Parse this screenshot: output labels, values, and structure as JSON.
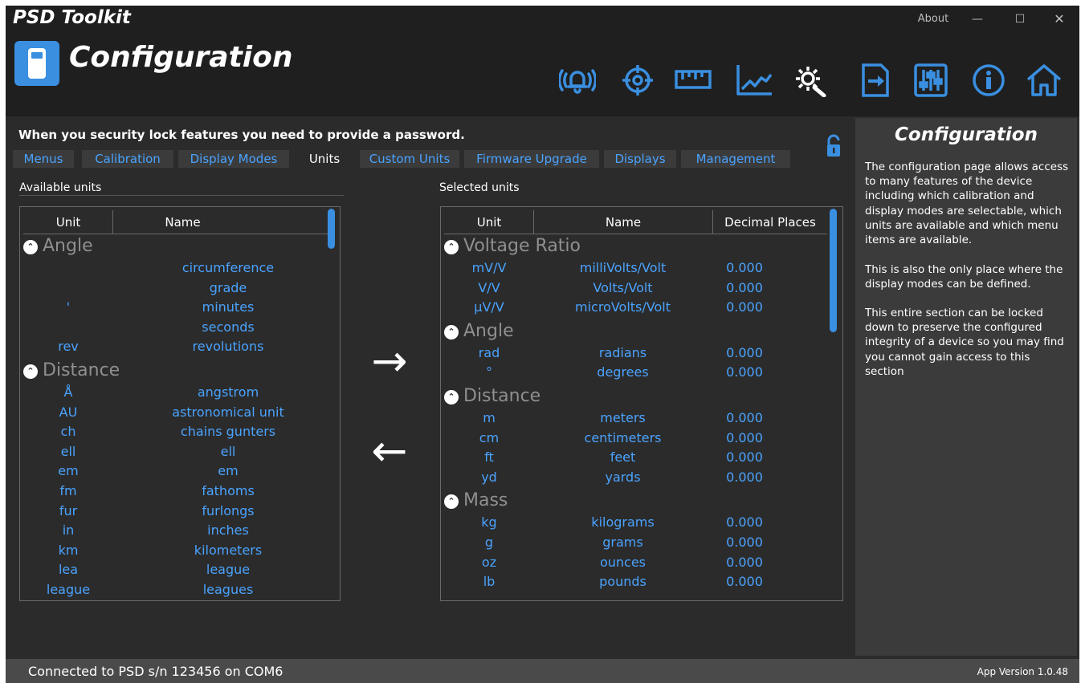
{
  "window": {
    "app_name": "PSD Toolkit",
    "about": "About",
    "minimize": "—",
    "maximize": "☐",
    "close": "✕"
  },
  "header": {
    "title": "Configuration",
    "toolbar_icons": [
      "alarm-icon",
      "target-icon",
      "ruler-icon",
      "chart-icon",
      "gear-wrench-icon",
      "file-transfer-icon",
      "sliders-icon",
      "info-icon",
      "home-icon"
    ],
    "accent_color": "#3a8fe0"
  },
  "notice": "When you security lock features you need to provide a password.",
  "tabs": [
    "Menus",
    "Calibration",
    "Display Modes",
    "Units",
    "Custom Units",
    "Firmware Upgrade",
    "Displays",
    "Management"
  ],
  "active_tab": "Units",
  "available": {
    "label": "Available units",
    "columns": [
      "Unit",
      "Name"
    ],
    "groups": [
      {
        "name": "Angle",
        "rows": [
          {
            "unit": "",
            "name": "circumference"
          },
          {
            "unit": "",
            "name": "grade"
          },
          {
            "unit": "'",
            "name": "minutes"
          },
          {
            "unit": "",
            "name": "seconds"
          },
          {
            "unit": "rev",
            "name": "revolutions"
          }
        ]
      },
      {
        "name": "Distance",
        "rows": [
          {
            "unit": "Å",
            "name": "angstrom"
          },
          {
            "unit": "AU",
            "name": "astronomical unit"
          },
          {
            "unit": "ch",
            "name": "chains gunters"
          },
          {
            "unit": "ell",
            "name": "ell"
          },
          {
            "unit": "em",
            "name": "em"
          },
          {
            "unit": "fm",
            "name": "fathoms"
          },
          {
            "unit": "fur",
            "name": "furlongs"
          },
          {
            "unit": "in",
            "name": "inches"
          },
          {
            "unit": "km",
            "name": "kilometers"
          },
          {
            "unit": "lea",
            "name": "league"
          },
          {
            "unit": "league",
            "name": "leagues"
          }
        ]
      }
    ]
  },
  "selected": {
    "label": "Selected units",
    "columns": [
      "Unit",
      "Name",
      "Decimal Places"
    ],
    "groups": [
      {
        "name": "Voltage Ratio",
        "rows": [
          {
            "unit": "mV/V",
            "name": "milliVolts/Volt",
            "dp": "0.000"
          },
          {
            "unit": "V/V",
            "name": "Volts/Volt",
            "dp": "0.000"
          },
          {
            "unit": "µV/V",
            "name": "microVolts/Volt",
            "dp": "0.000"
          }
        ]
      },
      {
        "name": "Angle",
        "rows": [
          {
            "unit": "rad",
            "name": "radians",
            "dp": "0.000"
          },
          {
            "unit": "°",
            "name": "degrees",
            "dp": "0.000"
          }
        ]
      },
      {
        "name": "Distance",
        "rows": [
          {
            "unit": "m",
            "name": "meters",
            "dp": "0.000"
          },
          {
            "unit": "cm",
            "name": "centimeters",
            "dp": "0.000"
          },
          {
            "unit": "ft",
            "name": "feet",
            "dp": "0.000"
          },
          {
            "unit": "yd",
            "name": "yards",
            "dp": "0.000"
          }
        ]
      },
      {
        "name": "Mass",
        "rows": [
          {
            "unit": "kg",
            "name": "kilograms",
            "dp": "0.000"
          },
          {
            "unit": "g",
            "name": "grams",
            "dp": "0.000"
          },
          {
            "unit": "oz",
            "name": "ounces",
            "dp": "0.000"
          },
          {
            "unit": "lb",
            "name": "pounds",
            "dp": "0.000"
          }
        ]
      }
    ]
  },
  "transfer": {
    "add": "→",
    "remove": "←"
  },
  "help": {
    "title": "Configuration",
    "paragraphs": [
      "The configuration page allows access to many features of the device including which calibration and display modes are selectable, which units are available and which menu items are available.",
      "This is also the only place where the display modes can be defined.",
      "This entire section can be locked down to preserve the configured integrity of a device so you may find you cannot gain access to this section"
    ]
  },
  "status": {
    "connection": "Connected to PSD s/n 123456 on COM6",
    "version": "App Version 1.0.48"
  }
}
